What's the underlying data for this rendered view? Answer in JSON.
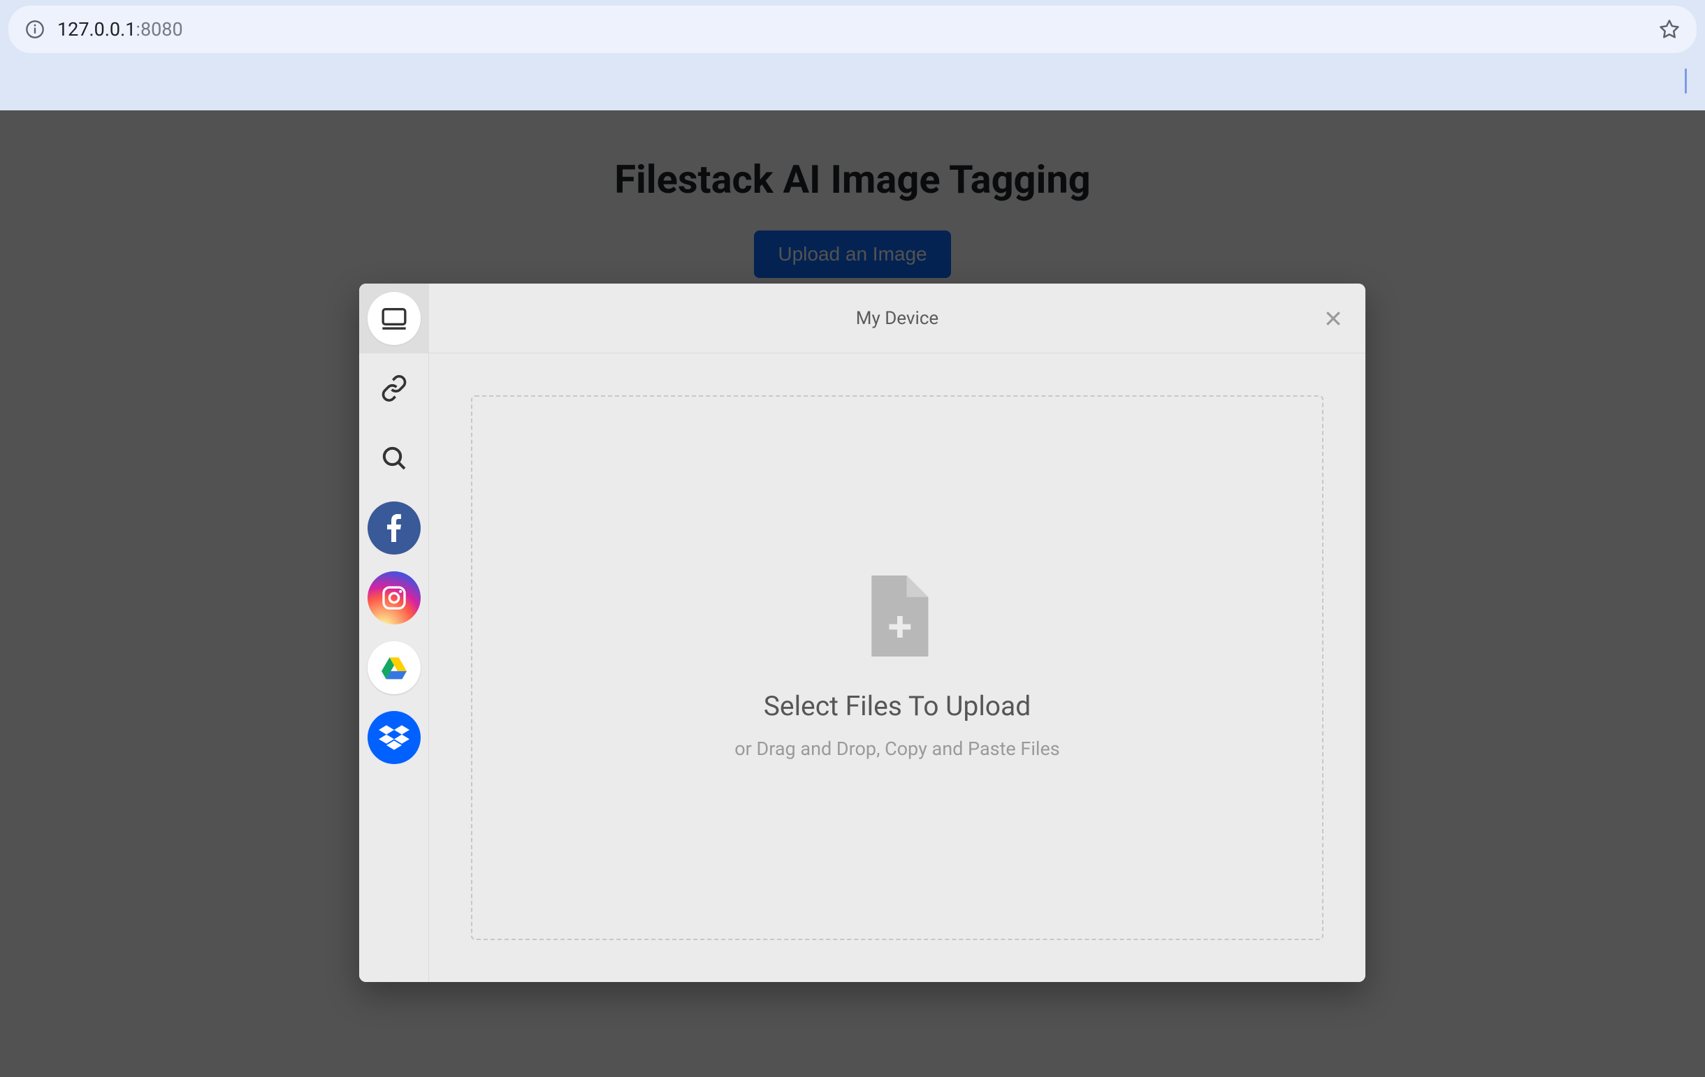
{
  "browser": {
    "url_host": "127.0.0.1",
    "url_port": ":8080"
  },
  "page": {
    "title": "Filestack AI Image Tagging",
    "upload_button_label": "Upload an Image"
  },
  "picker": {
    "header_title": "My Device",
    "dropzone": {
      "title": "Select Files To Upload",
      "subtitle": "or Drag and Drop, Copy and Paste Files"
    },
    "sources": [
      {
        "id": "local",
        "icon": "device-icon",
        "active": true
      },
      {
        "id": "url",
        "icon": "link-icon",
        "active": false
      },
      {
        "id": "search",
        "icon": "search-icon",
        "active": false
      },
      {
        "id": "facebook",
        "icon": "facebook-icon",
        "active": false
      },
      {
        "id": "instagram",
        "icon": "instagram-icon",
        "active": false
      },
      {
        "id": "gdrive",
        "icon": "googledrive-icon",
        "active": false
      },
      {
        "id": "dropbox",
        "icon": "dropbox-icon",
        "active": false
      }
    ]
  }
}
